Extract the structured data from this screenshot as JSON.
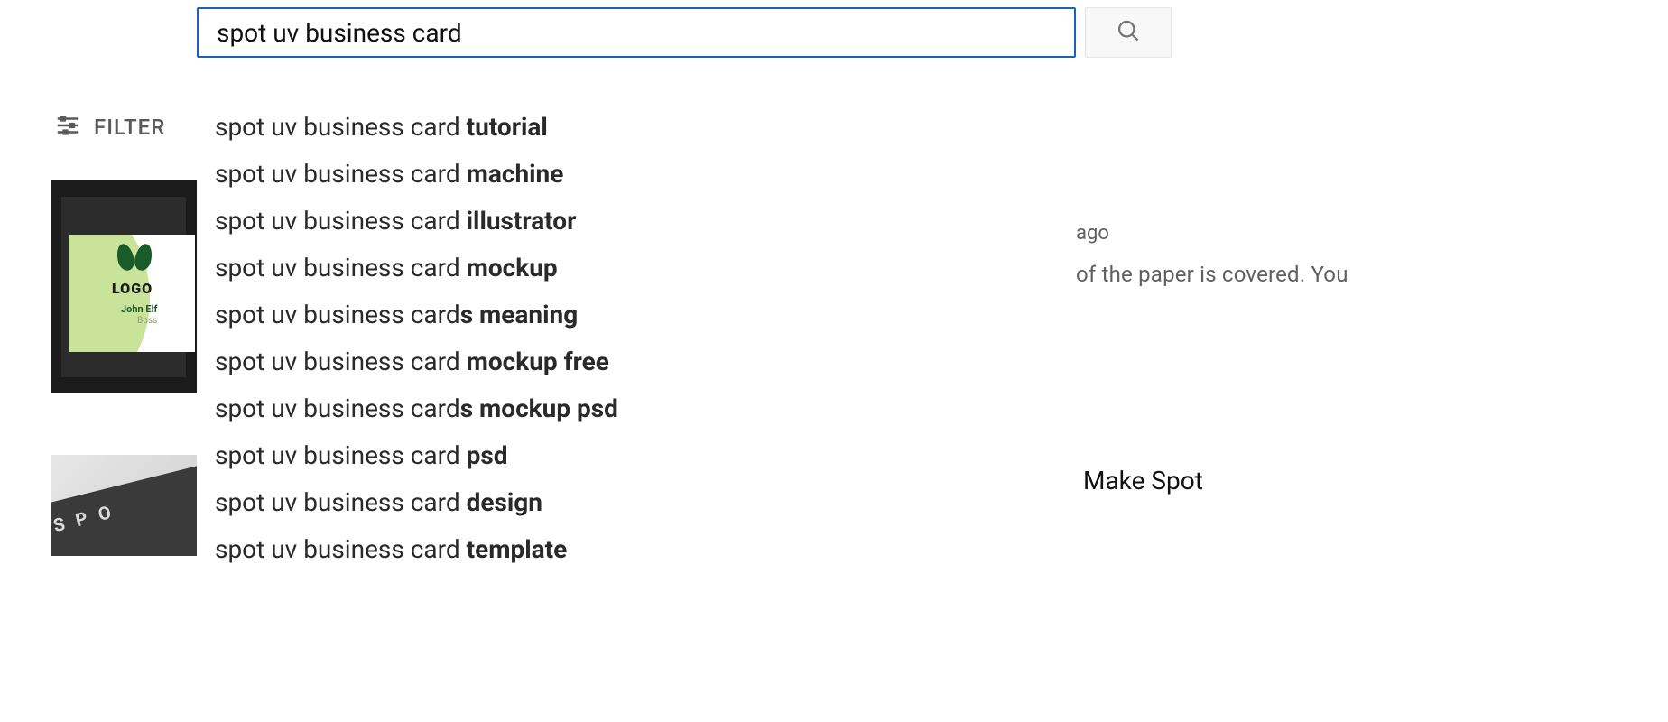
{
  "search": {
    "query": "spot uv business card"
  },
  "filter": {
    "label": "FILTER"
  },
  "suggestions": [
    {
      "prefix": "spot uv business card ",
      "suffix": "tutorial"
    },
    {
      "prefix": "spot uv business card ",
      "suffix": "machine"
    },
    {
      "prefix": "spot uv business card ",
      "suffix": "illustrator"
    },
    {
      "prefix": "spot uv business card ",
      "suffix": "mockup"
    },
    {
      "prefix": "spot uv business card",
      "suffix": "s meaning"
    },
    {
      "prefix": "spot uv business card ",
      "suffix": "mockup free"
    },
    {
      "prefix": "spot uv business card",
      "suffix": "s mockup psd"
    },
    {
      "prefix": "spot uv business card ",
      "suffix": "psd"
    },
    {
      "prefix": "spot uv business card ",
      "suffix": "design"
    },
    {
      "prefix": "spot uv business card ",
      "suffix": "template"
    }
  ],
  "thumb1": {
    "logo_text": "LOGO",
    "name": "John Elf",
    "role": "Boss"
  },
  "thumb2": {
    "text": "S P O"
  },
  "result_snippets": {
    "line1": "ago",
    "line2": "of the paper is covered. You",
    "title2": "Make Spot"
  }
}
